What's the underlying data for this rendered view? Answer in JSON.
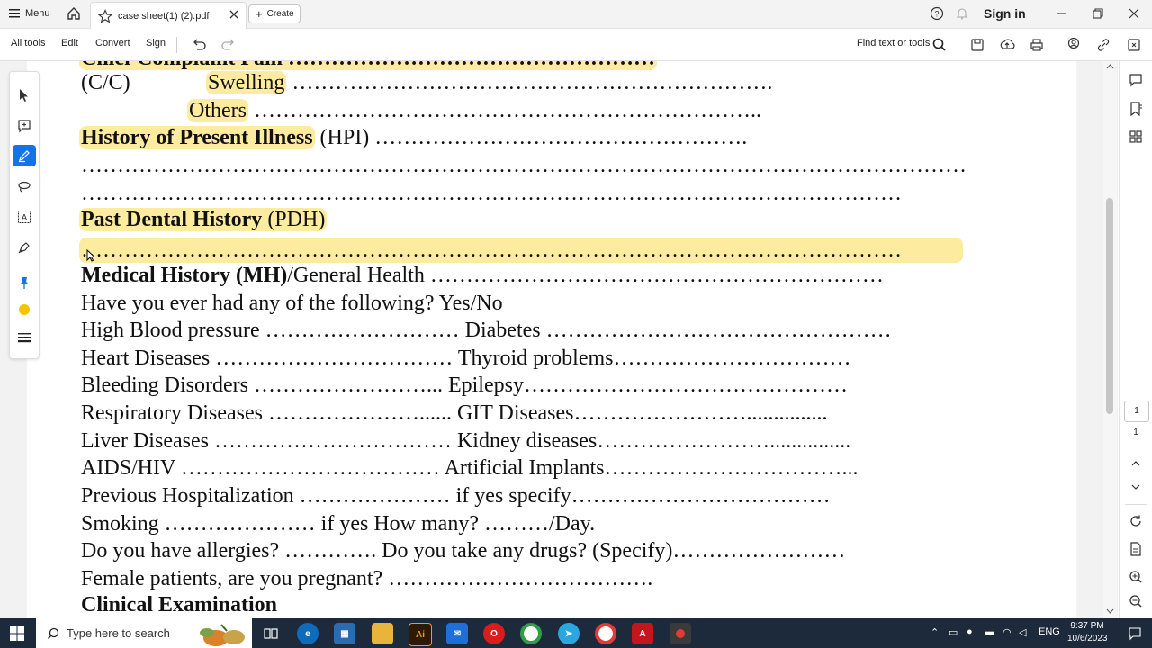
{
  "titlebar": {
    "menu_label": "Menu",
    "tab_title": "case sheet(1) (2).pdf",
    "create_label": "Create",
    "signin_label": "Sign in"
  },
  "toolbar": {
    "all_tools": "All tools",
    "edit": "Edit",
    "convert": "Convert",
    "sign": "Sign",
    "find_label": "Find text or tools"
  },
  "page_nav": {
    "current_page": "1",
    "total_pages": "1"
  },
  "document": {
    "chief_complaint": {
      "line1_text": "Chief Complaint  Pain ……………………………………………",
      "cc_label": "(C/C)",
      "swelling": "Swelling",
      "swelling_dots": "………………………………………………………….",
      "others": "Others",
      "others_dots": "…………………………………………………………….."
    },
    "hpi": {
      "label": "History of Present Illness",
      "abbr": "(HPI)",
      "dots1": "…………………………………………….",
      "dots2": "……………………………………………………………………………………………………………",
      "dots3": "……………………………………………………………………………………………………"
    },
    "pdh": {
      "label": "Past Dental History",
      "abbr": "(PDH)",
      "dots": "……………………………………………………………………………………………………"
    },
    "mh": {
      "label": "Medical History (MH)",
      "rest": "/General Health ………………………………………………………"
    },
    "lines": [
      "Have you ever had any of the following? Yes/No",
      "High Blood pressure ……………………… Diabetes …………………………………………",
      "Heart Diseases …………………………… Thyroid problems……………………………",
      "Bleeding Disorders ……………………... Epilepsy………………………………………",
      "Respiratory Diseases …………………...... GIT Diseases……………………...............",
      "Liver Diseases …………………………… Kidney diseases……………………...............",
      "AIDS/HIV ……………………………… Artificial Implants……………………………...",
      "Previous Hospitalization …………………  if yes specify………………………………",
      "Smoking ………………… if yes How many? ………/Day.",
      "Do you have allergies? …………. Do you take any drugs? (Specify)……………………",
      "Female patients, are you pregnant? ………………………………."
    ],
    "clinical_exam": "Clinical Examination"
  },
  "taskbar": {
    "search_placeholder": "Type here to search",
    "language": "ENG",
    "time": "9:37 PM",
    "date": "10/6/2023"
  },
  "colors": {
    "highlight": "#fdeca0",
    "accent": "#1473e6",
    "taskbar": "#1d2a3b",
    "annotation_dot": "#f5c400"
  }
}
